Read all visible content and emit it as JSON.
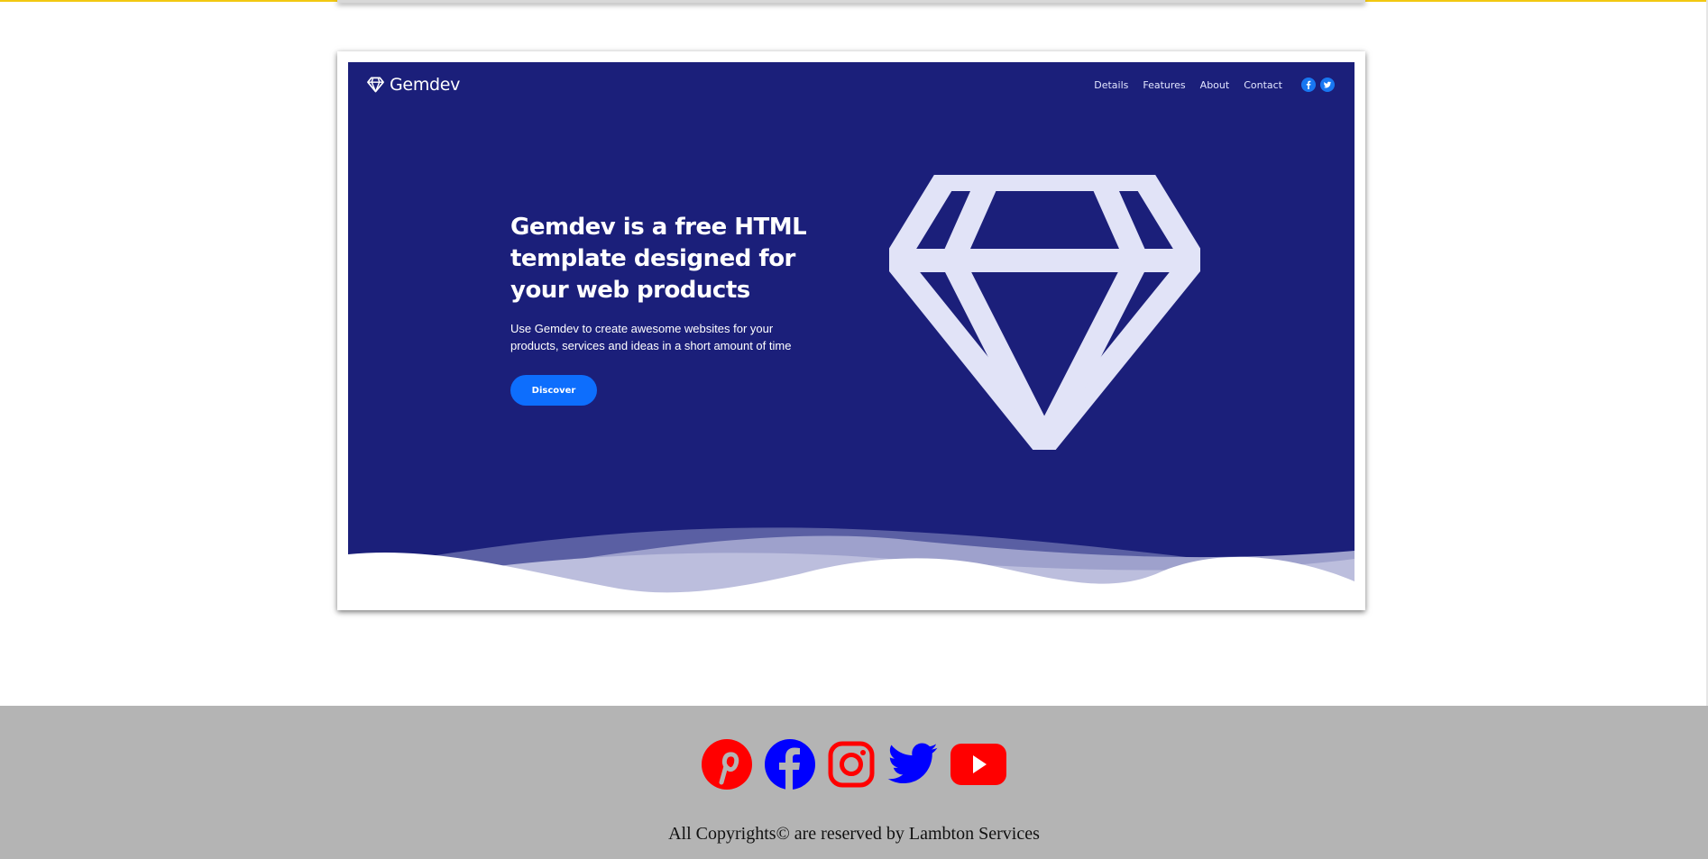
{
  "colors": {
    "accent_bar": "#f2c811",
    "hero_background": "#1b1f7a",
    "button_blue": "#0d6efd",
    "footer_background": "#b4b4b4",
    "social_red": "#ff0000",
    "social_blue": "#0000ff"
  },
  "preview": {
    "logo_text": "Gemdev",
    "nav": [
      "Details",
      "Features",
      "About",
      "Contact"
    ],
    "nav_social_icons": [
      "facebook-icon",
      "twitter-icon"
    ],
    "headline": "Gemdev is a free HTML template designed for your web products",
    "description": "Use Gemdev to create awesome websites for your products, services and ideas in a short amount of time",
    "button_label": "Discover"
  },
  "footer": {
    "social_icons": [
      "pinterest-icon",
      "facebook-icon",
      "instagram-icon",
      "twitter-icon",
      "youtube-icon"
    ],
    "copyright": "All Copyrights© are reserved by Lambton Services"
  }
}
